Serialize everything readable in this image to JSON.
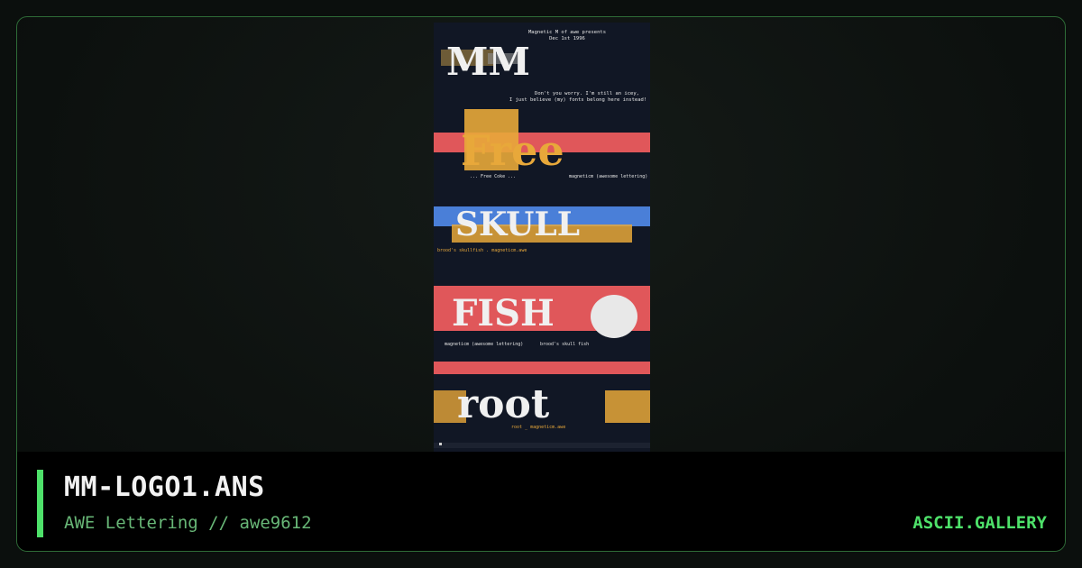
{
  "artwork": {
    "header_line1": "Magnetic M of awe presents",
    "header_line2": "Dec 1st 1996",
    "note_line1": "Don't you worry.  I'm still an icey,",
    "note_line2": "I just believe (my) fonts belong here instead!",
    "logo_mm": "MM",
    "logo_free": "Free",
    "caption_free_left": "... Free Coke ...",
    "caption_free_right": "magneticm (awesome lettering)",
    "logo_skull": "SKULL",
    "caption_skull": "brood's skullfish . magneticm.awe",
    "logo_fish": "FISH",
    "caption_fish_left": "magneticm (awesome lettering)",
    "caption_fish_right": "brood's skull fish",
    "logo_root": "root",
    "caption_root": "root _ magneticm.awe",
    "colors": {
      "salmon": "#e0575a",
      "gold": "#e8a83a",
      "blue": "#4a7fd8",
      "white": "#f0f0f0",
      "caption": "#e8a83a"
    }
  },
  "footer": {
    "title": "MM-LOGO1.ANS",
    "subtitle": "AWE Lettering // awe9612",
    "brand": "ASCII.GALLERY"
  },
  "accent_color": "#4ee16a"
}
